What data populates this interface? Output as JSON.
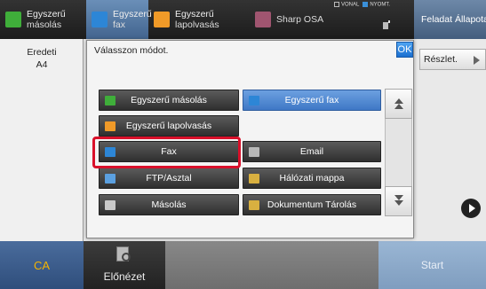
{
  "tabs": [
    {
      "line1": "Egyszerű",
      "line2": "másolás",
      "icon_color": "#3fae3a",
      "active": false
    },
    {
      "line1": "Egyszerű",
      "line2": "fax",
      "icon_color": "#2d86d6",
      "active": true
    },
    {
      "line1": "Egyszerű",
      "line2": "lapolvasás",
      "icon_color": "#f09a28",
      "active": false
    },
    {
      "line1": "Sharp OSA",
      "line2": "",
      "icon_color": "#a05570",
      "active": false
    }
  ],
  "status": {
    "vonal": "VONAL",
    "nyomt": "NYOMT."
  },
  "feladat": "Feladat Állapota",
  "left_panel": {
    "line1": "Eredeti",
    "line2": "A4"
  },
  "reszlet": "Részlet.",
  "dialog": {
    "title": "Válasszon módot.",
    "ok": "OK",
    "options": [
      {
        "label": "Egyszerű másolás",
        "icon_color": "#3fae3a",
        "selected": false
      },
      {
        "label": "Egyszerű fax",
        "icon_color": "#2d86d6",
        "selected": true
      },
      {
        "label": "Egyszerű lapolvasás",
        "icon_color": "#f09a28",
        "selected": false
      },
      {
        "label": "Fax",
        "icon_color": "#2d86d6",
        "selected": false
      },
      {
        "label": "Email",
        "icon_color": "#b8b8b8",
        "selected": false
      },
      {
        "label": "FTP/Asztal",
        "icon_color": "#5ba0e0",
        "selected": false
      },
      {
        "label": "Hálózati mappa",
        "icon_color": "#d8b040",
        "selected": false
      },
      {
        "label": "Másolás",
        "icon_color": "#c8c8c8",
        "selected": false
      },
      {
        "label": "Dokumentum Tárolás",
        "icon_color": "#d8b040",
        "selected": false
      }
    ]
  },
  "bottom": {
    "ca": "CA",
    "elonezet": "Előnézet",
    "start": "Start"
  },
  "colors": {
    "highlight": "#d9102a",
    "accent": "#3f78c6"
  }
}
